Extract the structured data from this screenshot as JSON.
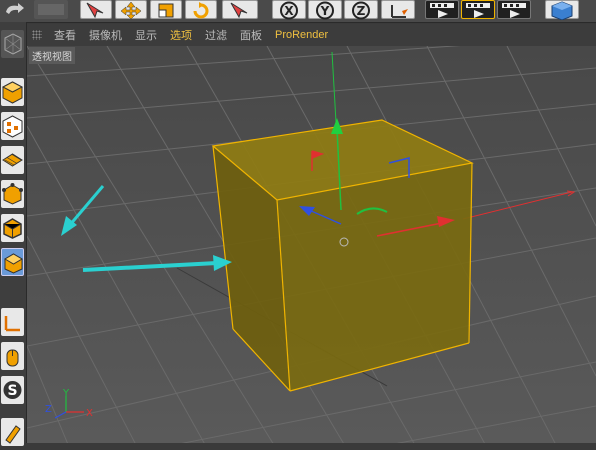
{
  "menu": {
    "items": [
      "查看",
      "摄像机",
      "显示",
      "选项",
      "过滤",
      "面板",
      "ProRender"
    ],
    "active_index": 3
  },
  "viewport": {
    "label": "透视视图",
    "axis_labels": {
      "x": "X",
      "y": "Y",
      "z": "Z"
    }
  },
  "toolbar_buttons": [
    {
      "icon": "undo-icon"
    },
    {
      "icon": "live-selection-icon"
    },
    {
      "icon": "move-icon"
    },
    {
      "icon": "scale-icon"
    },
    {
      "icon": "rotate-icon"
    },
    {
      "icon": "selection-arrow-icon"
    },
    {
      "icon": "x-axis-lock-icon",
      "label": "X"
    },
    {
      "icon": "y-axis-lock-icon",
      "label": "Y"
    },
    {
      "icon": "z-axis-lock-icon",
      "label": "Z"
    },
    {
      "icon": "coordinate-system-icon"
    },
    {
      "icon": "render-view-icon"
    },
    {
      "icon": "render-picture-viewer-icon"
    },
    {
      "icon": "render-settings-icon"
    },
    {
      "icon": "cube-object-icon"
    }
  ],
  "left_tools": [
    {
      "icon": "make-editable-icon"
    },
    {
      "icon": "model-mode-icon"
    },
    {
      "icon": "texture-mode-icon"
    },
    {
      "icon": "workplane-mode-icon"
    },
    {
      "icon": "points-mode-icon"
    },
    {
      "icon": "edges-mode-icon"
    },
    {
      "icon": "polygons-mode-icon"
    },
    {
      "icon": "axis-mode-icon"
    },
    {
      "icon": "tweak-mode-icon"
    },
    {
      "icon": "snap-icon"
    },
    {
      "icon": "brush-icon"
    }
  ],
  "colors": {
    "cube_fill": "#8a7410",
    "cube_edge": "#f0b400",
    "annotation_arrow": "#2ad0d0",
    "axis_x": "#e03030",
    "axis_y": "#20c040",
    "axis_z": "#3050e0",
    "menu_active": "#f0c040"
  }
}
